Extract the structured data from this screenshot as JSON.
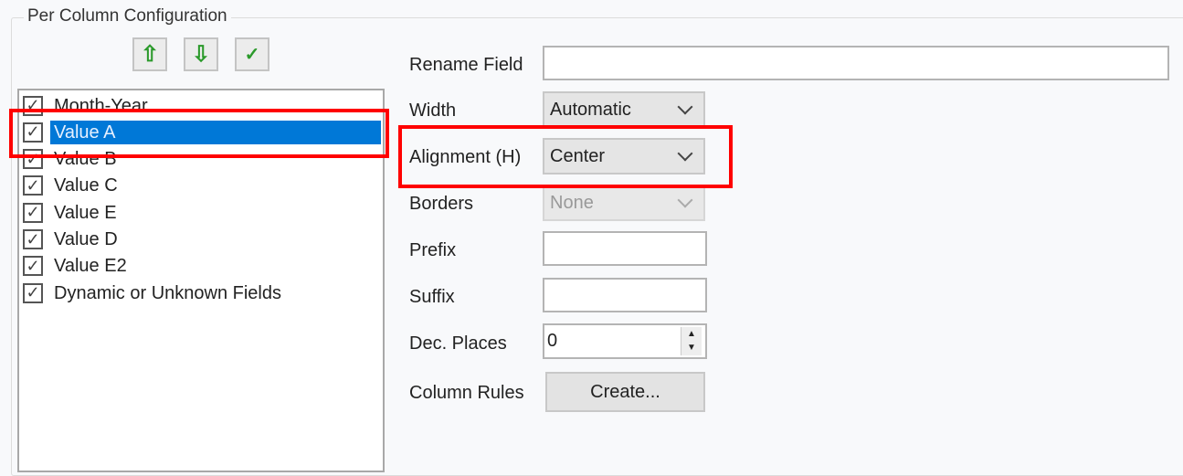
{
  "group_title": "Per Column Configuration",
  "toolbar": {
    "move_up_icon": "arrow-up-icon",
    "move_down_icon": "arrow-down-icon",
    "check_all_icon": "checkmark-icon"
  },
  "columns": [
    {
      "label": "Month-Year",
      "checked": true
    },
    {
      "label": "Value A",
      "checked": true,
      "selected": true
    },
    {
      "label": "Value B",
      "checked": true
    },
    {
      "label": "Value C",
      "checked": true
    },
    {
      "label": "Value E",
      "checked": true
    },
    {
      "label": "Value D",
      "checked": true
    },
    {
      "label": "Value E2",
      "checked": true
    },
    {
      "label": "Dynamic or Unknown Fields",
      "checked": true
    }
  ],
  "form": {
    "rename_label": "Rename Field",
    "rename_value": "",
    "width_label": "Width",
    "width_value": "Automatic",
    "alignment_label": "Alignment (H)",
    "alignment_value": "Center",
    "borders_label": "Borders",
    "borders_value": "None",
    "prefix_label": "Prefix",
    "prefix_value": "",
    "suffix_label": "Suffix",
    "suffix_value": "",
    "dec_label": "Dec. Places",
    "dec_value": "0",
    "rules_label": "Column Rules",
    "create_label": "Create..."
  },
  "highlight_color": "#ff0000",
  "selection_color": "#0078d7"
}
